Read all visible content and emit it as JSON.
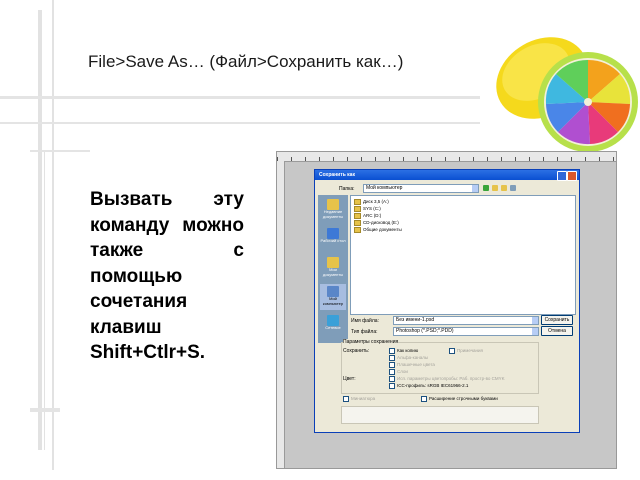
{
  "title": "File>Save As… (Файл>Сохранить как…)",
  "body_text": "Вызвать эту команду можно также с помощью сочетания клавиш Shift+Ctlr+S.",
  "dialog": {
    "title": "Сохранить как",
    "folder_label": "Папка:",
    "folder_value": "Мой компьютер",
    "places": [
      "Недавние документы",
      "Рабочий стол",
      "Мои документы",
      "Мой компьютер",
      "Сетевое"
    ],
    "files": [
      "Диск 3,5 (A:)",
      "SYS (C:)",
      "ARC (D:)",
      "CD-дисковод (E:)",
      "Общие документы"
    ],
    "filename_label": "Имя файла:",
    "filename_value": "Без имени-1.psd",
    "filetype_label": "Тип файла:",
    "filetype_value": "Photoshop (*.PSD;*.PDD)",
    "save_button": "Сохранить",
    "cancel_button": "Отмена",
    "params_label": "Параметры сохранения",
    "save_label": "Сохранить:",
    "copy_check": "Как копию",
    "alpha_check": "Альфа-каналы",
    "notes_check": "Примечания",
    "spot_check": "Плашечные цвета",
    "layers_check": "Слои",
    "color_label": "Цвет:",
    "proof_check": "Исп. параметры цветопробы: Раб. простр-во CMYK",
    "icc_check": "ICC-профиль:  sRGB IEC61966-2.1",
    "thumb_check": "Миниатюра",
    "ext_check": "Расширение строчными буквами"
  },
  "colors": {
    "title_bar": "#0a4fd1",
    "dialog_bg": "#ece9d8",
    "places_bar": "#7f9db9"
  }
}
